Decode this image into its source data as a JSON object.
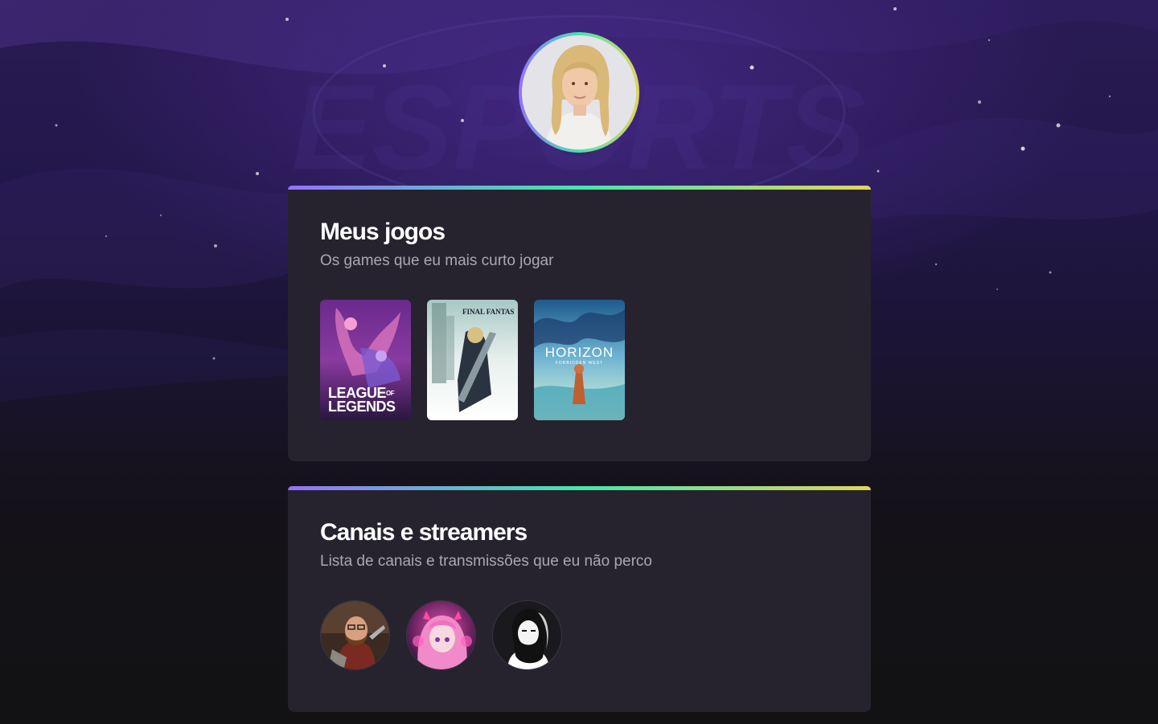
{
  "profile": {
    "avatar_icon": "profile-photo"
  },
  "games_section": {
    "title": "Meus jogos",
    "subtitle": "Os games que eu mais curto jogar",
    "games": [
      {
        "name": "League of Legends",
        "logo_line1": "LEAGUE",
        "logo_of": "OF",
        "logo_line2": "LEGENDS"
      },
      {
        "name": "Final Fantasy VII Remake",
        "logo_line1": "FINAL FANTASY VII"
      },
      {
        "name": "Horizon Forbidden West",
        "logo_line1": "HORIZON",
        "logo_line2": "FORBIDDEN WEST"
      }
    ]
  },
  "streamers_section": {
    "title": "Canais e streamers",
    "subtitle": "Lista de canais e transmissões que eu não perco",
    "streamers": [
      {
        "icon": "streamer-avatar-1"
      },
      {
        "icon": "streamer-avatar-2"
      },
      {
        "icon": "streamer-avatar-3"
      }
    ]
  },
  "colors": {
    "gradient_start": "#9572fc",
    "gradient_mid": "#43e7ad",
    "gradient_end": "#e2d45c",
    "card_bg": "#26232f",
    "title": "#ffffff",
    "subtitle": "#a8a8b3"
  }
}
